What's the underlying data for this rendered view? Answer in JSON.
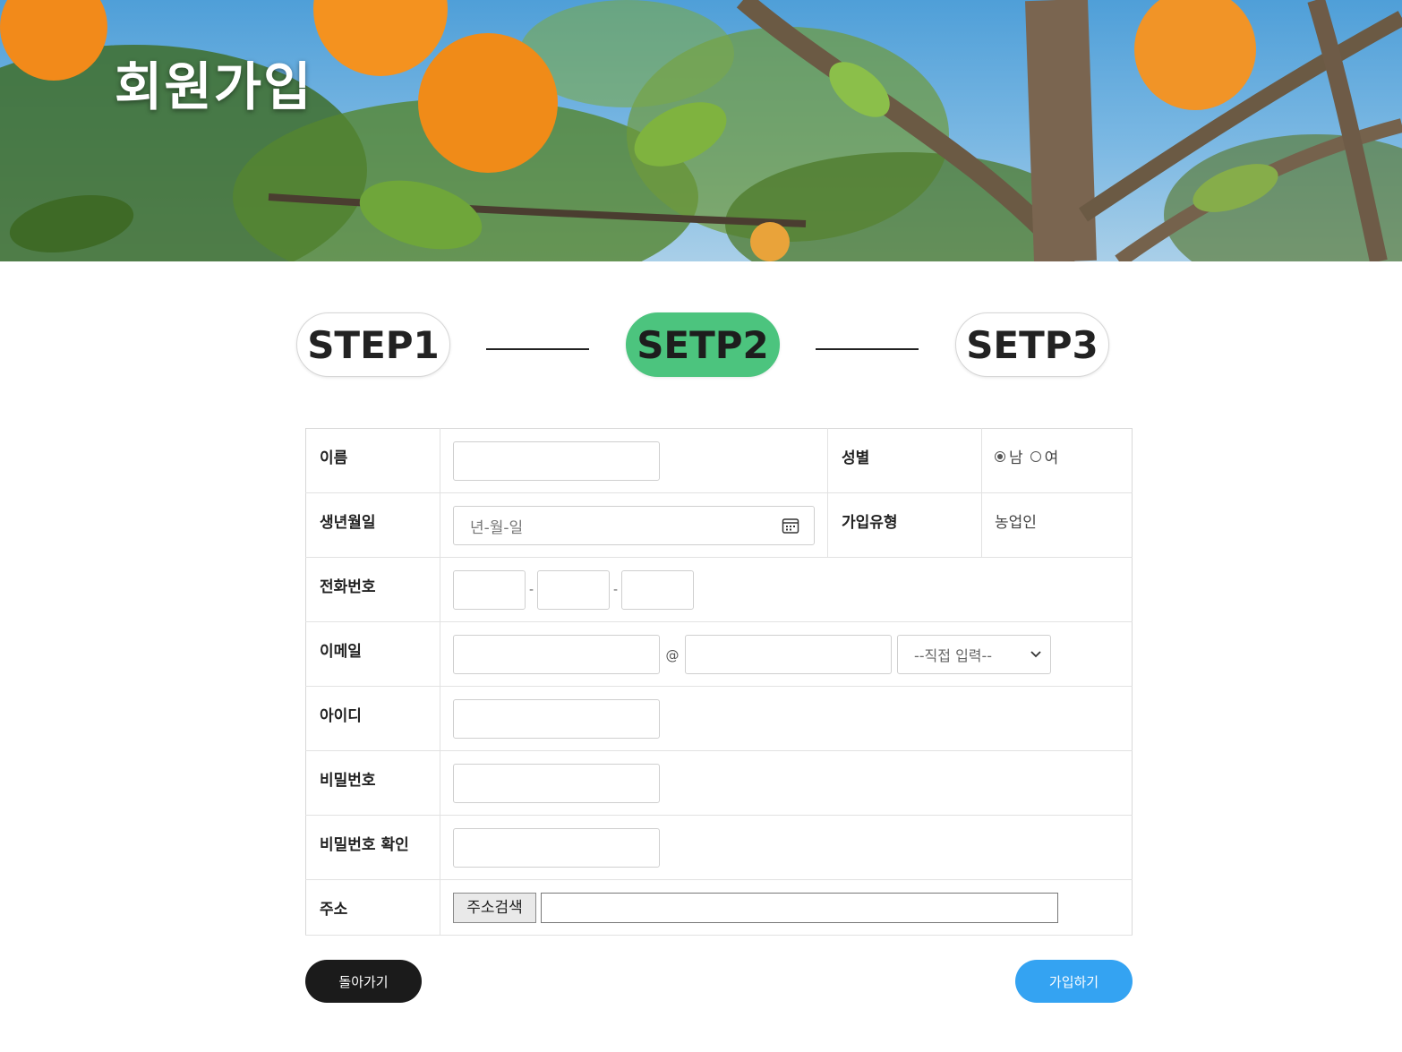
{
  "hero": {
    "title": "회원가입"
  },
  "steps": [
    {
      "label": "STEP1",
      "active": false
    },
    {
      "label": "SETP2",
      "active": true
    },
    {
      "label": "SETP3",
      "active": false
    }
  ],
  "form": {
    "name_label": "이름",
    "gender_label": "성별",
    "gender_options": [
      "남",
      "여"
    ],
    "gender_selected": "남",
    "birth_label": "생년월일",
    "birth_placeholder": "년-월-일",
    "type_label": "가입유형",
    "type_value": "농업인",
    "phone_label": "전화번호",
    "phone_separator": "-",
    "email_label": "이메일",
    "email_at": "@",
    "email_domain_select": "--직접 입력--",
    "id_label": "아이디",
    "password_label": "비밀번호",
    "password_confirm_label": "비밀번호 확인",
    "address_label": "주소",
    "address_search_button": "주소검색"
  },
  "buttons": {
    "back": "돌아가기",
    "join": "가입하기"
  },
  "colors": {
    "step_active": "#4cc47e",
    "join_button": "#34a3f2",
    "back_button": "#1b1b1b"
  }
}
